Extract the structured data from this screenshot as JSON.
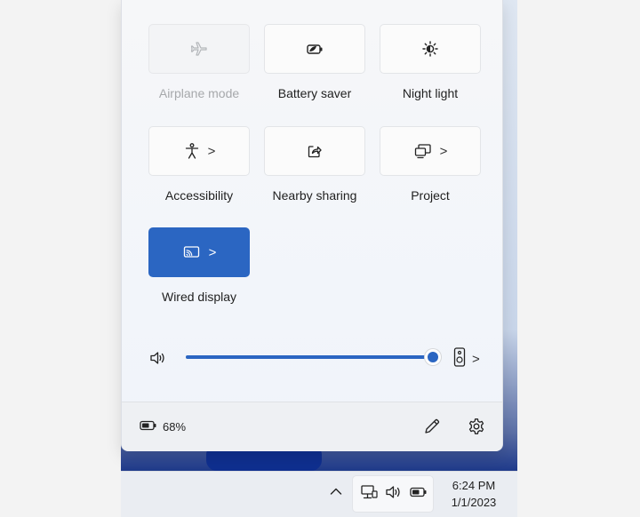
{
  "quick_settings": {
    "tiles": [
      {
        "id": "airplane",
        "label": "Airplane mode",
        "icon": "airplane-icon",
        "state": "disabled",
        "has_chevron": false
      },
      {
        "id": "battery-saver",
        "label": "Battery saver",
        "icon": "battery-saver-icon",
        "state": "off",
        "has_chevron": false
      },
      {
        "id": "night-light",
        "label": "Night light",
        "icon": "night-light-icon",
        "state": "off",
        "has_chevron": false
      },
      {
        "id": "accessibility",
        "label": "Accessibility",
        "icon": "accessibility-icon",
        "state": "off",
        "has_chevron": true
      },
      {
        "id": "nearby-sharing",
        "label": "Nearby sharing",
        "icon": "share-icon",
        "state": "off",
        "has_chevron": false
      },
      {
        "id": "project",
        "label": "Project",
        "icon": "project-icon",
        "state": "off",
        "has_chevron": true
      },
      {
        "id": "wired-display",
        "label": "Wired display",
        "icon": "cast-icon",
        "state": "active",
        "has_chevron": true
      }
    ],
    "chevron_glyph": ">",
    "volume": {
      "level": 1.0,
      "icon": "speaker-icon",
      "output_icon": "speaker-device-icon"
    },
    "footer": {
      "battery_percent": "68%",
      "battery_icon": "battery-icon",
      "edit_icon": "pencil-icon",
      "settings_icon": "gear-icon"
    }
  },
  "taskbar": {
    "tray_chevron": "^",
    "tray_icons": [
      "network-icon",
      "speaker-icon",
      "battery-icon"
    ],
    "time": "6:24 PM",
    "date": "1/1/2023"
  },
  "colors": {
    "accent": "#2b66c2",
    "disabled_text": "#a6a8ab"
  }
}
